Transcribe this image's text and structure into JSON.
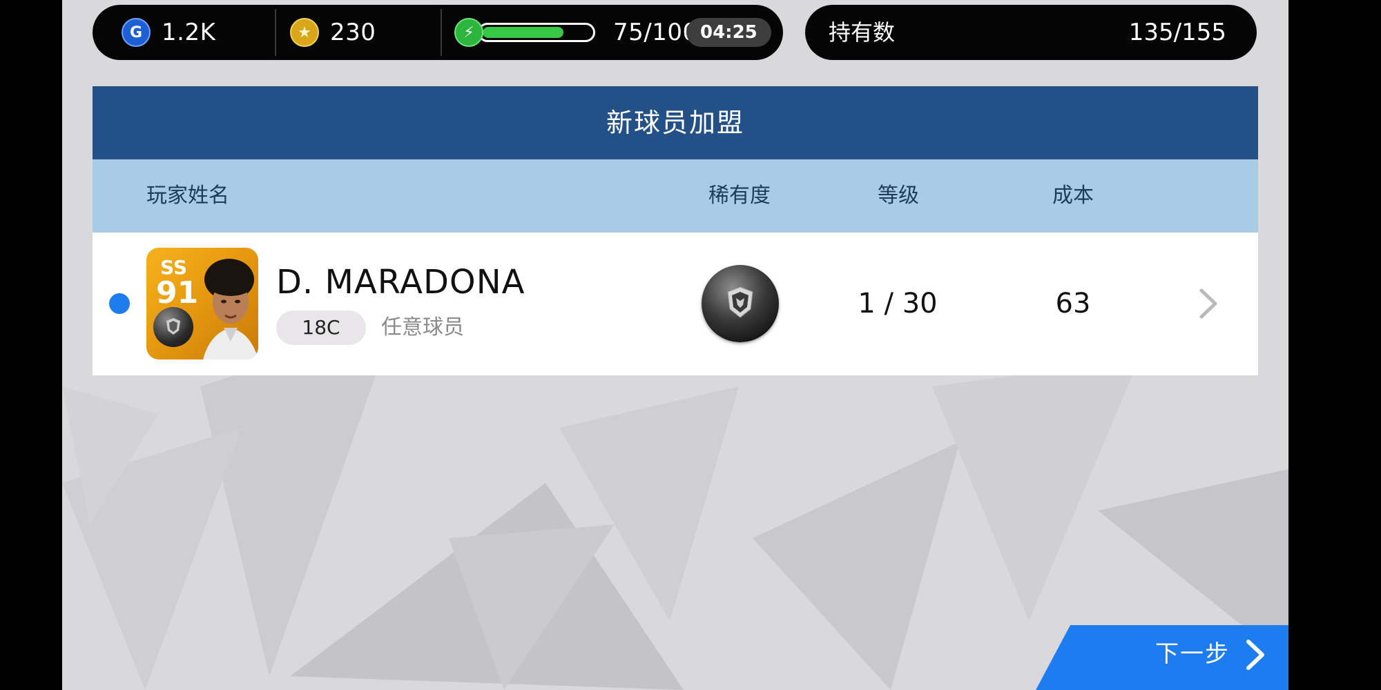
{
  "currency": {
    "gp": "1.2K",
    "coins": "230",
    "energy_text": "75/100",
    "energy_fraction": 0.75,
    "timer": "04:25"
  },
  "holdings": {
    "label": "持有数",
    "value": "135/155"
  },
  "panel": {
    "title": "新球员加盟",
    "columns": {
      "name": "玩家姓名",
      "rarity": "稀有度",
      "level": "等级",
      "cost": "成本"
    }
  },
  "player": {
    "position": "SS",
    "rating": "91",
    "name": "D. MARADONA",
    "type_tag": "18C",
    "category": "任意球员",
    "level": "1 / 30",
    "cost": "63"
  },
  "next_button": {
    "label": "下一步"
  },
  "colors": {
    "header_blue": "#235086",
    "subheader_blue": "#a9cce6",
    "accent_blue": "#1c7cf0"
  },
  "icons": {
    "gp": "gp-icon",
    "coin": "coin-star-icon",
    "energy": "lightning-icon",
    "rarity": "black-ball-icon",
    "row_chevron": "chevron-right-icon",
    "next_chevron": "chevron-right-icon"
  }
}
